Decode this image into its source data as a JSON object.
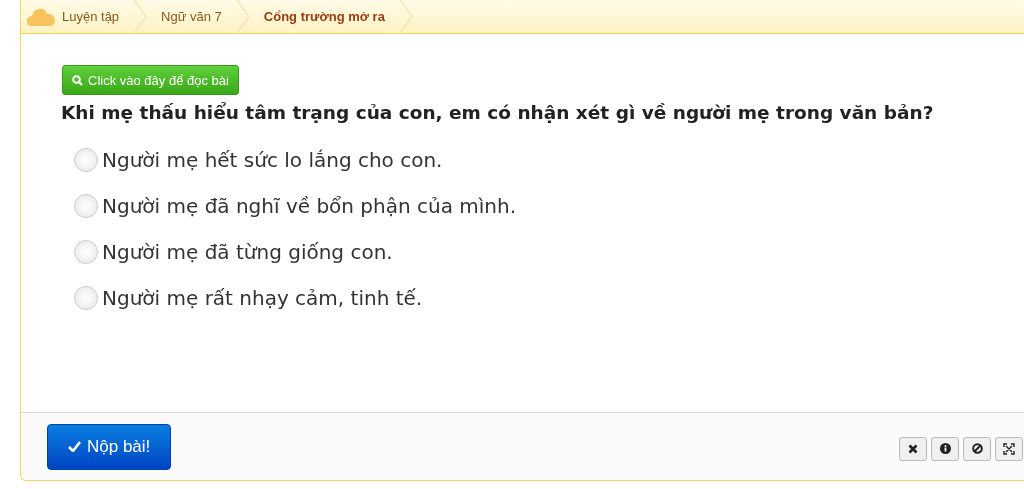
{
  "breadcrumb": [
    {
      "label": "Luyện tập",
      "current": false
    },
    {
      "label": "Ngữ văn 7",
      "current": false
    },
    {
      "label": "Cổng trường mở ra",
      "current": true
    }
  ],
  "read_button": "Click vào đây để đọc bài",
  "question": "Khi mẹ thấu hiểu tâm trạng của con, em có nhận xét gì về người mẹ trong văn bản?",
  "options": [
    {
      "label": "Người mẹ hết sức lo lắng cho con.",
      "selected": false
    },
    {
      "label": "Người mẹ đã nghĩ về bổn phận của mình.",
      "selected": false
    },
    {
      "label": "Người mẹ đã từng giống con.",
      "selected": false
    },
    {
      "label": "Người mẹ rất nhạy cảm, tinh tế.",
      "selected": false
    }
  ],
  "submit_button": "Nộp bài!",
  "tools": [
    {
      "kind": "close"
    },
    {
      "kind": "info"
    },
    {
      "kind": "block"
    },
    {
      "kind": "fullscreen"
    }
  ]
}
